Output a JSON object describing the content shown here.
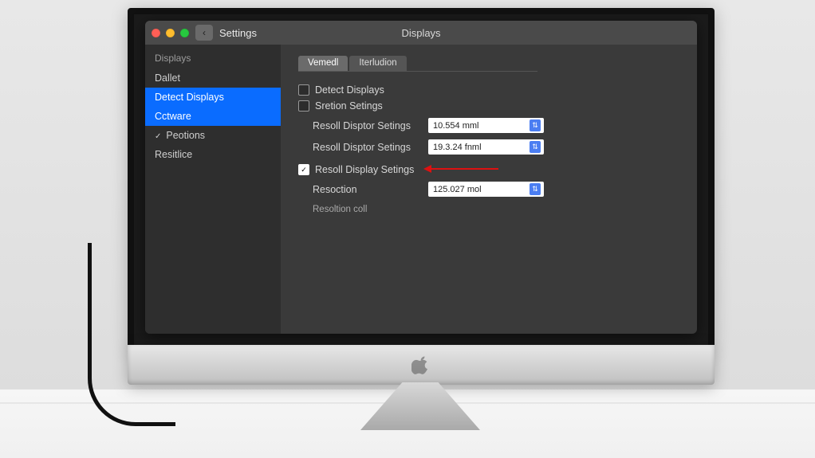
{
  "titlebar": {
    "app": "Settings",
    "page": "Displays"
  },
  "sidebar": {
    "heading": "Displays",
    "items": [
      {
        "label": "Dallet"
      },
      {
        "label": "Detect Displays"
      },
      {
        "label": "Cctware"
      },
      {
        "label": "Peotions"
      },
      {
        "label": "Resitlice"
      }
    ]
  },
  "tabs": [
    {
      "label": "Vemedl"
    },
    {
      "label": "Iterludion"
    }
  ],
  "checks": {
    "detect": "Detect Displays",
    "station": "Sretion Setings"
  },
  "rows": [
    {
      "label": "Resoll Disptor Setings",
      "value": "10.554 mml"
    },
    {
      "label": "Resoll Disptor Setings",
      "value": "19.3.24 fnml"
    }
  ],
  "resetCheck": "Resoll Display Setings",
  "resolution": {
    "label": "Resoction",
    "value": "125.027 mol"
  },
  "hint": "Resoltion coll"
}
